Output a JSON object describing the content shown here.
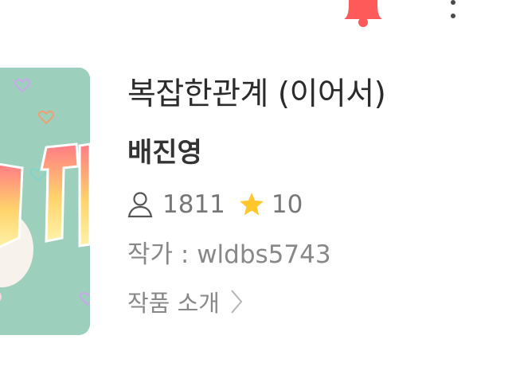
{
  "header": {
    "bell_icon": "bell-icon",
    "more_icon": "more-vertical-icon",
    "bell_color": "#ff5a5a"
  },
  "novel": {
    "cover_icon": "cover-image",
    "title": "복잡한관계 (이어서)",
    "author_name": "배진영",
    "views_icon": "user-icon",
    "views": "1811",
    "rating_icon": "star-icon",
    "rating": "10",
    "writer_line": "작가 : wldbs5743",
    "intro_label": "작품 소개"
  },
  "colors": {
    "text_dark": "#2b2b2b",
    "text_muted": "#888888",
    "star": "#ffc72c",
    "cover_bg": "#9dcfbd"
  }
}
